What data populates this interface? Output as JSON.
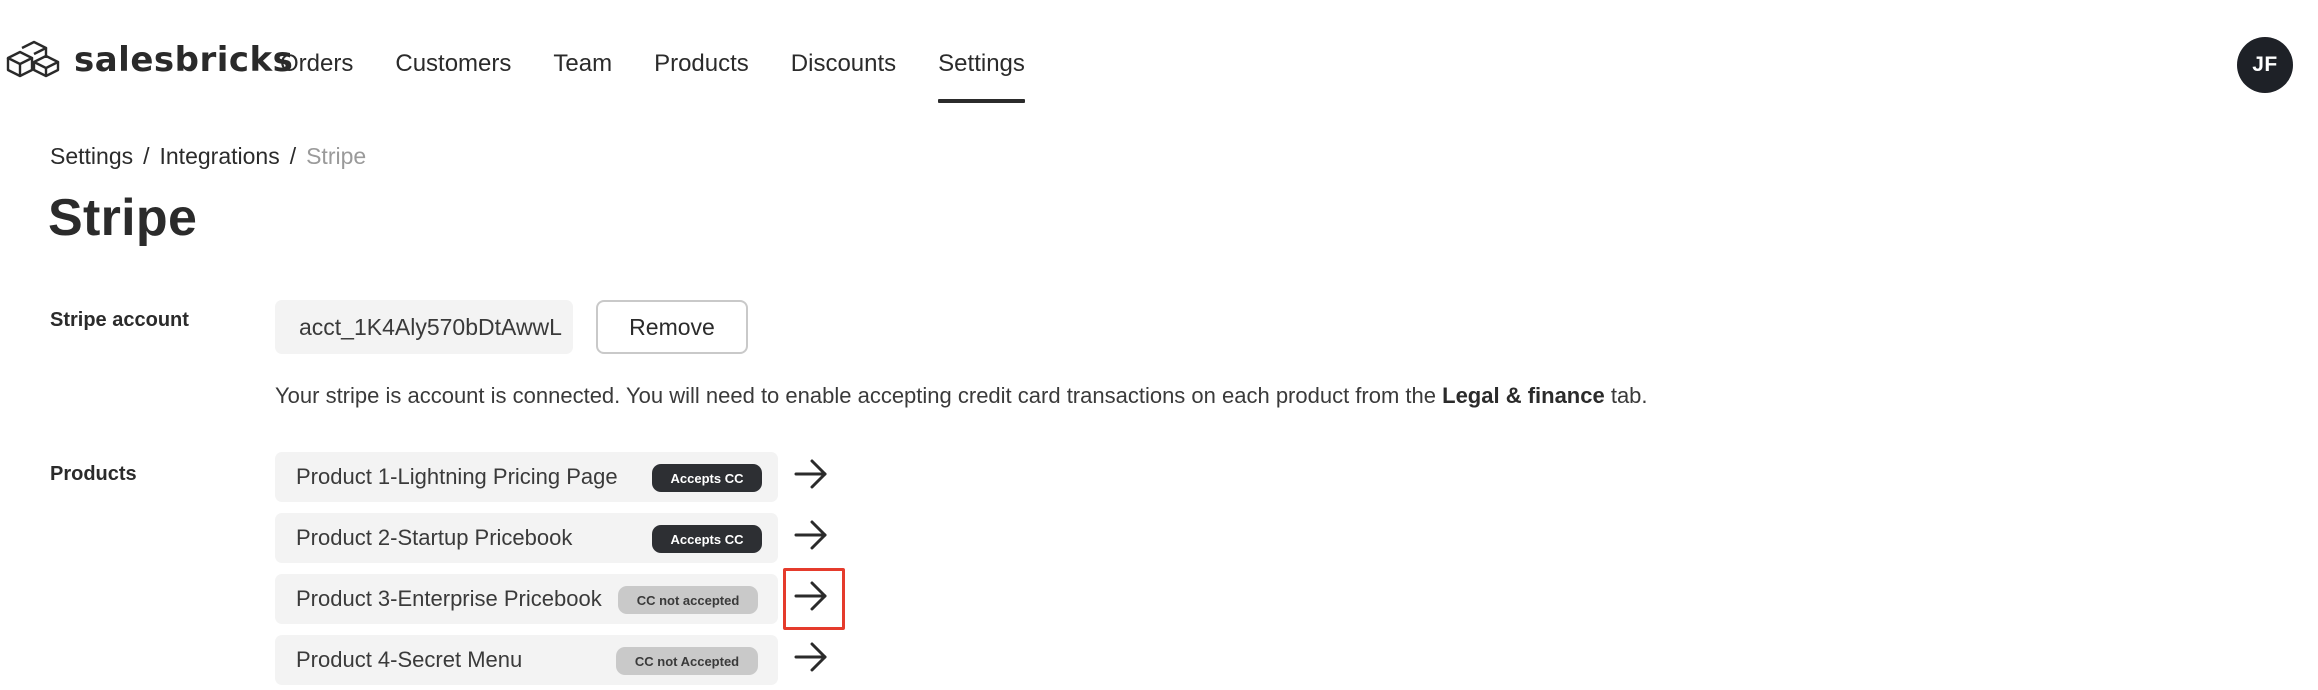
{
  "brand": {
    "name": "salesbricks",
    "logo_icon": "bricks-logo-icon"
  },
  "nav": {
    "items": [
      {
        "label": "Orders",
        "active": false
      },
      {
        "label": "Customers",
        "active": false
      },
      {
        "label": "Team",
        "active": false
      },
      {
        "label": "Products",
        "active": false
      },
      {
        "label": "Discounts",
        "active": false
      },
      {
        "label": "Settings",
        "active": true
      }
    ]
  },
  "user": {
    "initials": "JF"
  },
  "breadcrumb": {
    "items": [
      "Settings",
      "Integrations"
    ],
    "separator": "/",
    "current": "Stripe"
  },
  "page": {
    "title": "Stripe"
  },
  "stripe_account": {
    "label": "Stripe account",
    "account_id": "acct_1K4Aly570bDtAwwL",
    "remove_label": "Remove",
    "help_text_before": "Your stripe is account is connected. You will need to enable accepting credit card transactions on each product from the ",
    "help_text_bold": "Legal & finance",
    "help_text_after": " tab."
  },
  "products": {
    "label": "Products",
    "items": [
      {
        "name": "Product 1-Lightning Pricing Page",
        "badge": "Accepts CC",
        "accepts_cc": true
      },
      {
        "name": "Product 2-Startup Pricebook",
        "badge": "Accepts CC",
        "accepts_cc": true
      },
      {
        "name": "Product 3-Enterprise Pricebook",
        "badge": "CC not accepted",
        "accepts_cc": false
      },
      {
        "name": "Product 4-Secret Menu",
        "badge": "CC not Accepted",
        "accepts_cc": false
      }
    ]
  },
  "colors": {
    "text": "#2b2b2b",
    "muted": "#9a9a9a",
    "field_bg": "#f3f3f3",
    "badge_dark": "#2d2f33",
    "badge_light": "#c9c9c9",
    "highlight": "#e53b2c"
  }
}
